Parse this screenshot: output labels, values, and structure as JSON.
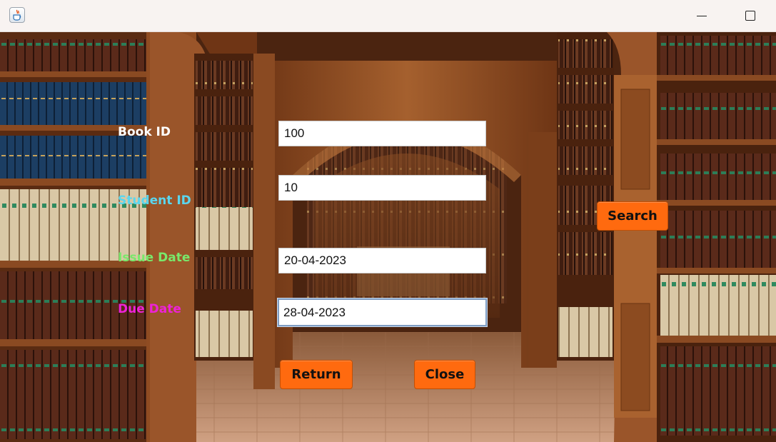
{
  "window": {
    "title": "",
    "app_icon": "java-cup-icon",
    "minimize_icon": "minimize-icon",
    "maximize_icon": "maximize-icon"
  },
  "form": {
    "book_id": {
      "label": "Book ID",
      "value": "100",
      "label_color": "#ffffff"
    },
    "student_id": {
      "label": "Student ID",
      "value": "10",
      "label_color": "#5ad6ee"
    },
    "issue_date": {
      "label": "Issue Date",
      "value": "20-04-2023",
      "label_color": "#79e86b"
    },
    "due_date": {
      "label": "Due Date",
      "value": "28-04-2023",
      "label_color": "#ee22d8"
    }
  },
  "buttons": {
    "search": "Search",
    "return": "Return",
    "close": "Close"
  },
  "colors": {
    "button_accent": "#ff6a0f",
    "titlebar": "#f8f3f1"
  },
  "background": "library-bookshelves-image"
}
